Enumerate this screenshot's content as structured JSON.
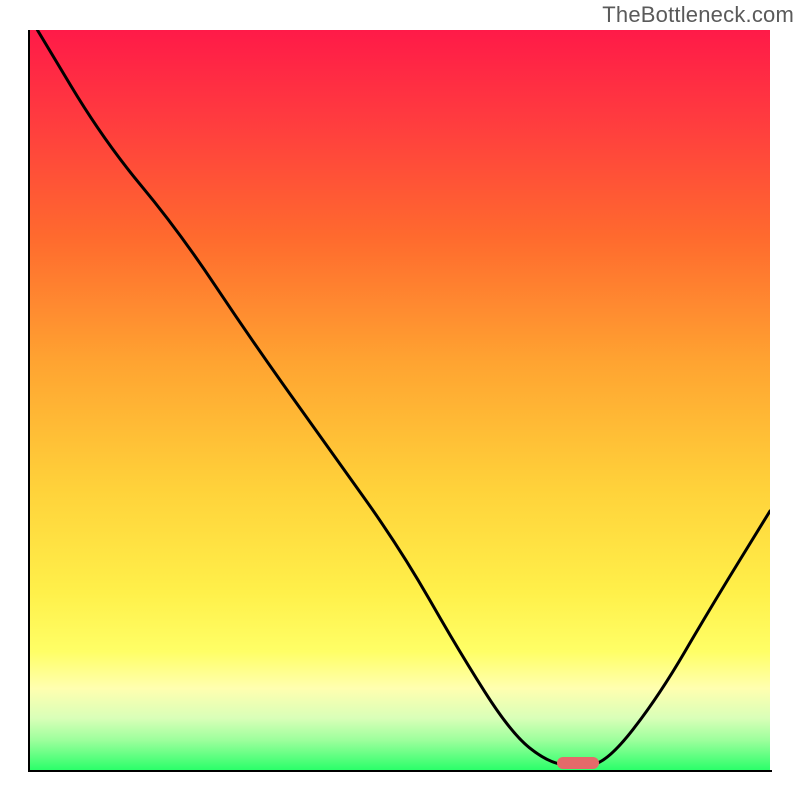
{
  "watermark": "TheBottleneck.com",
  "chart_data": {
    "type": "line",
    "title": "",
    "xlabel": "",
    "ylabel": "",
    "xlim": [
      0,
      100
    ],
    "ylim": [
      0,
      100
    ],
    "grid": false,
    "legend": false,
    "single_curve": {
      "name": "bottleneck-curve",
      "points": [
        {
          "x": 1,
          "y": 100
        },
        {
          "x": 10,
          "y": 85
        },
        {
          "x": 20,
          "y": 73
        },
        {
          "x": 30,
          "y": 58
        },
        {
          "x": 40,
          "y": 44
        },
        {
          "x": 50,
          "y": 30
        },
        {
          "x": 58,
          "y": 16
        },
        {
          "x": 65,
          "y": 5
        },
        {
          "x": 70,
          "y": 1
        },
        {
          "x": 74,
          "y": 0.5
        },
        {
          "x": 78,
          "y": 1
        },
        {
          "x": 85,
          "y": 10
        },
        {
          "x": 92,
          "y": 22
        },
        {
          "x": 100,
          "y": 35
        }
      ]
    },
    "optimal_marker": {
      "x": 74,
      "y": 1
    },
    "gradient_stops": [
      {
        "pos": 0,
        "color": "#ff1a48"
      },
      {
        "pos": 50,
        "color": "#ffd23a"
      },
      {
        "pos": 88,
        "color": "#ffffb0"
      },
      {
        "pos": 100,
        "color": "#2bff6a"
      }
    ]
  }
}
